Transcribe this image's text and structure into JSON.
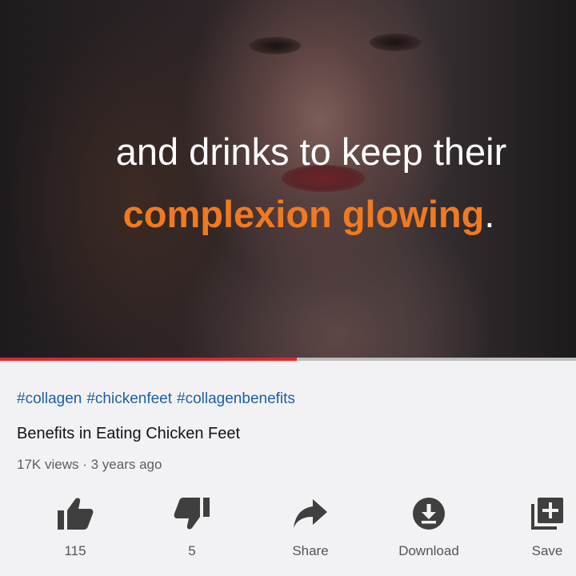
{
  "video": {
    "caption_line1": "and drinks to keep their",
    "caption_line2_highlight": "complexion glowing",
    "caption_line2_end": ".",
    "highlight_color": "#f07a1f",
    "progress": 0.515
  },
  "hashtags": [
    "#collagen",
    "#chickenfeet",
    "#collagenbenefits"
  ],
  "title": "Benefits in Eating Chicken Feet",
  "meta": {
    "views": "17K views",
    "separator": "·",
    "age": "3 years ago"
  },
  "actions": {
    "like": {
      "icon": "thumbs-up-icon",
      "label": "115"
    },
    "dislike": {
      "icon": "thumbs-down-icon",
      "label": "5"
    },
    "share": {
      "icon": "share-arrow-icon",
      "label": "Share"
    },
    "download": {
      "icon": "download-icon",
      "label": "Download"
    },
    "save": {
      "icon": "add-to-playlist-icon",
      "label": "Save"
    }
  }
}
